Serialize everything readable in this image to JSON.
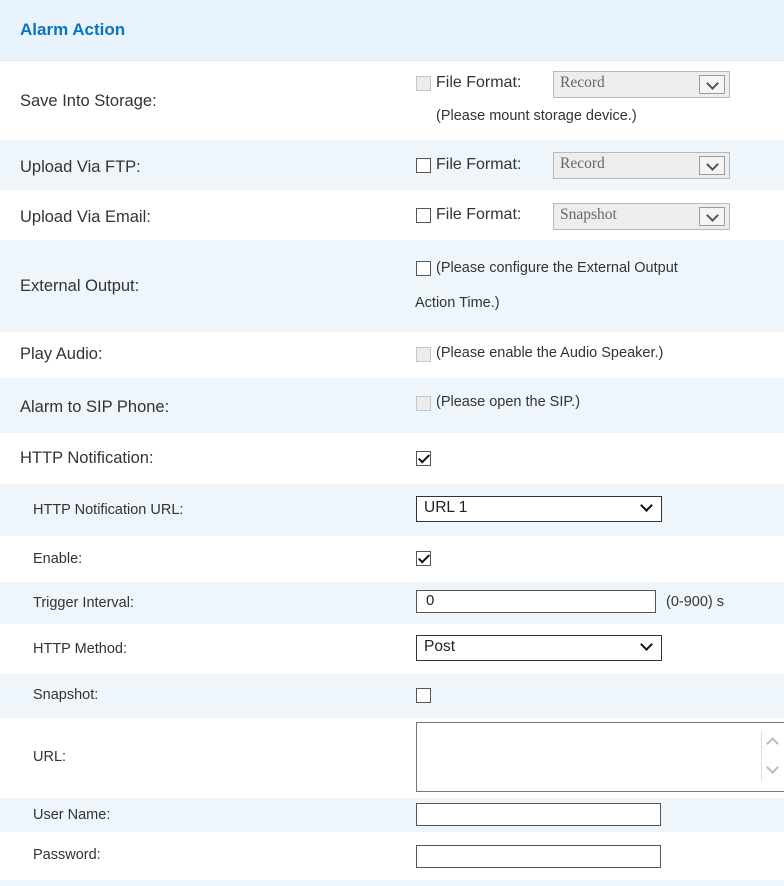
{
  "section": {
    "title": "Alarm Action"
  },
  "rows": {
    "save_storage": {
      "label": "Save Into Storage:",
      "file_format_label": "File Format:",
      "format_value": "Record",
      "note": "(Please mount storage device.)"
    },
    "upload_ftp": {
      "label": "Upload Via FTP:",
      "file_format_label": "File Format:",
      "format_value": "Record"
    },
    "upload_email": {
      "label": "Upload Via Email:",
      "file_format_label": "File Format:",
      "format_value": "Snapshot"
    },
    "external_output": {
      "label": "External Output:",
      "note_line1": "(Please configure the External Output",
      "note_line2": "Action Time.)"
    },
    "play_audio": {
      "label": "Play Audio:",
      "note": "(Please enable the Audio Speaker.)"
    },
    "sip_phone": {
      "label": "Alarm to SIP Phone:",
      "note": "(Please open the SIP.)"
    },
    "http_notification": {
      "label": "HTTP Notification:"
    },
    "http_url": {
      "label": "HTTP Notification URL:",
      "value": "URL 1"
    },
    "enable": {
      "label": "Enable:"
    },
    "trigger_interval": {
      "label": "Trigger Interval:",
      "value": "0",
      "hint": "(0-900) s"
    },
    "http_method": {
      "label": "HTTP Method:",
      "value": "Post"
    },
    "snapshot": {
      "label": "Snapshot:"
    },
    "url": {
      "label": "URL:"
    },
    "user_name": {
      "label": "User Name:",
      "value": ""
    },
    "password": {
      "label": "Password:",
      "value": ""
    }
  },
  "colors": {
    "header_bg": "#e9f3fb",
    "alt_row_bg": "#eef6fc",
    "title_color": "#0a74c4"
  }
}
